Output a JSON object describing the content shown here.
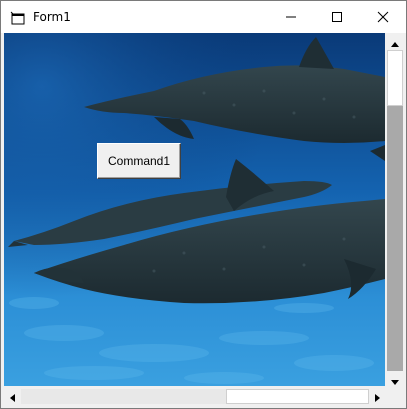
{
  "window": {
    "title": "Form1",
    "icon": "vb-form-icon",
    "caption_buttons": [
      "minimize-icon",
      "maximize-icon",
      "close-icon"
    ]
  },
  "picture": {
    "subject": "underwater-dolphins-photo",
    "colors": {
      "water_dark": "#0a3f7a",
      "water_light": "#2e8ad0",
      "dolphin": "#2c3d44"
    }
  },
  "controls": {
    "command_button_label": "Command1"
  },
  "scrollbars": {
    "vertical_position": 0.0,
    "horizontal_position": 0.6
  }
}
